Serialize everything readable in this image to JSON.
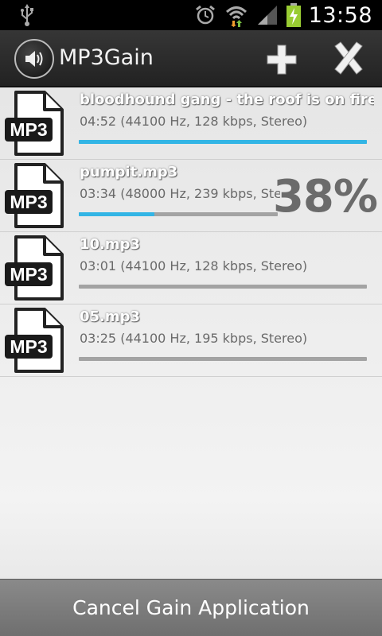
{
  "status_bar": {
    "time": "13:58",
    "icons": [
      "usb-icon",
      "alarm-icon",
      "wifi-icon",
      "signal-icon",
      "battery-charging-icon"
    ]
  },
  "action_bar": {
    "title": "MP3Gain",
    "app_icon": "speaker-icon",
    "add_icon": "plus-icon",
    "close_icon": "x-icon"
  },
  "colors": {
    "accent": "#33b5e5",
    "track": "#a3a3a3"
  },
  "files": [
    {
      "name": "bloodhound gang - the roof is on fire...",
      "info": "04:52 (44100 Hz, 128 kbps, Stereo)",
      "progress": 1.0,
      "percent_label": ""
    },
    {
      "name": "pumpit.mp3",
      "info": "03:34 (48000 Hz, 239 kbps, Ste...",
      "progress": 0.38,
      "percent_label": "38%"
    },
    {
      "name": "10.mp3",
      "info": "03:01 (44100 Hz, 128 kbps, Stereo)",
      "progress": 0,
      "percent_label": ""
    },
    {
      "name": "05.mp3",
      "info": "03:25 (44100 Hz, 195 kbps, Stereo)",
      "progress": 0,
      "percent_label": ""
    }
  ],
  "file_icon_label": "MP3",
  "bottom_button": {
    "label": "Cancel Gain Application"
  }
}
